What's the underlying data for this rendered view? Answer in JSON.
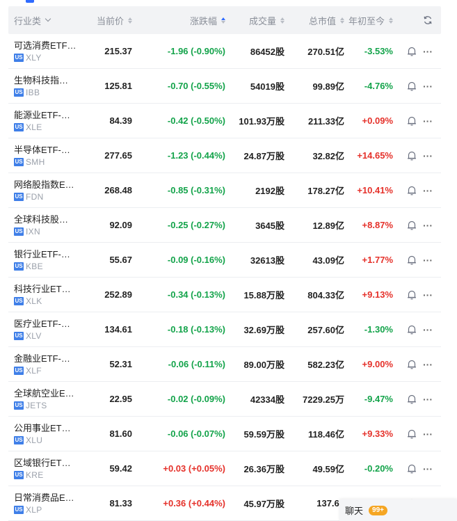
{
  "header": {
    "industry": "行业类",
    "price": "当前价",
    "change": "涨跌幅",
    "volume": "成交量",
    "market_cap": "总市值",
    "ytd": "年初至今"
  },
  "rows": [
    {
      "name": "可选消费ETF…",
      "badge": "US",
      "ticker": "XLY",
      "price": "215.37",
      "change": "-1.96 (-0.90%)",
      "change_dir": "down",
      "volume": "86452股",
      "market_cap": "270.51亿",
      "ytd": "-3.53%",
      "ytd_dir": "down"
    },
    {
      "name": "生物科技指…",
      "badge": "US",
      "ticker": "IBB",
      "price": "125.81",
      "change": "-0.70 (-0.55%)",
      "change_dir": "down",
      "volume": "54019股",
      "market_cap": "99.89亿",
      "ytd": "-4.76%",
      "ytd_dir": "down"
    },
    {
      "name": "能源业ETF-…",
      "badge": "US",
      "ticker": "XLE",
      "price": "84.39",
      "change": "-0.42 (-0.50%)",
      "change_dir": "down",
      "volume": "101.93万股",
      "market_cap": "211.33亿",
      "ytd": "+0.09%",
      "ytd_dir": "up"
    },
    {
      "name": "半导体ETF-…",
      "badge": "US",
      "ticker": "SMH",
      "price": "277.65",
      "change": "-1.23 (-0.44%)",
      "change_dir": "down",
      "volume": "24.87万股",
      "market_cap": "32.82亿",
      "ytd": "+14.65%",
      "ytd_dir": "up"
    },
    {
      "name": "网络股指数E…",
      "badge": "US",
      "ticker": "FDN",
      "price": "268.48",
      "change": "-0.85 (-0.31%)",
      "change_dir": "down",
      "volume": "2192股",
      "market_cap": "178.27亿",
      "ytd": "+10.41%",
      "ytd_dir": "up"
    },
    {
      "name": "全球科技股…",
      "badge": "US",
      "ticker": "IXN",
      "price": "92.09",
      "change": "-0.25 (-0.27%)",
      "change_dir": "down",
      "volume": "3645股",
      "market_cap": "12.89亿",
      "ytd": "+8.87%",
      "ytd_dir": "up"
    },
    {
      "name": "银行业ETF-…",
      "badge": "US",
      "ticker": "KBE",
      "price": "55.67",
      "change": "-0.09 (-0.16%)",
      "change_dir": "down",
      "volume": "32613股",
      "market_cap": "43.09亿",
      "ytd": "+1.77%",
      "ytd_dir": "up"
    },
    {
      "name": "科技行业ET…",
      "badge": "US",
      "ticker": "XLK",
      "price": "252.89",
      "change": "-0.34 (-0.13%)",
      "change_dir": "down",
      "volume": "15.88万股",
      "market_cap": "804.33亿",
      "ytd": "+9.13%",
      "ytd_dir": "up"
    },
    {
      "name": "医疗业ETF-…",
      "badge": "US",
      "ticker": "XLV",
      "price": "134.61",
      "change": "-0.18 (-0.13%)",
      "change_dir": "down",
      "volume": "32.69万股",
      "market_cap": "257.60亿",
      "ytd": "-1.30%",
      "ytd_dir": "down"
    },
    {
      "name": "金融业ETF-…",
      "badge": "US",
      "ticker": "XLF",
      "price": "52.31",
      "change": "-0.06 (-0.11%)",
      "change_dir": "down",
      "volume": "89.00万股",
      "market_cap": "582.23亿",
      "ytd": "+9.00%",
      "ytd_dir": "up"
    },
    {
      "name": "全球航空业E…",
      "badge": "US",
      "ticker": "JETS",
      "price": "22.95",
      "change": "-0.02 (-0.09%)",
      "change_dir": "down",
      "volume": "42334股",
      "market_cap": "7229.25万",
      "ytd": "-9.47%",
      "ytd_dir": "down"
    },
    {
      "name": "公用事业ET…",
      "badge": "US",
      "ticker": "XLU",
      "price": "81.60",
      "change": "-0.06 (-0.07%)",
      "change_dir": "down",
      "volume": "59.59万股",
      "market_cap": "118.46亿",
      "ytd": "+9.33%",
      "ytd_dir": "up"
    },
    {
      "name": "区域银行ET…",
      "badge": "US",
      "ticker": "KRE",
      "price": "59.42",
      "change": "+0.03 (+0.05%)",
      "change_dir": "up",
      "volume": "26.36万股",
      "market_cap": "49.59亿",
      "ytd": "-0.20%",
      "ytd_dir": "down"
    },
    {
      "name": "日常消费品E…",
      "badge": "US",
      "ticker": "XLP",
      "price": "81.33",
      "change": "+0.36 (+0.44%)",
      "change_dir": "up",
      "volume": "45.97万股",
      "market_cap": "137.63",
      "ytd": "",
      "ytd_dir": "up"
    }
  ],
  "chat": {
    "label": "聊天",
    "count": "99+"
  },
  "colors": {
    "up": "#e5312a",
    "down": "#13a34a",
    "accent": "#2f6bff",
    "badge": "#3f7fe8"
  }
}
